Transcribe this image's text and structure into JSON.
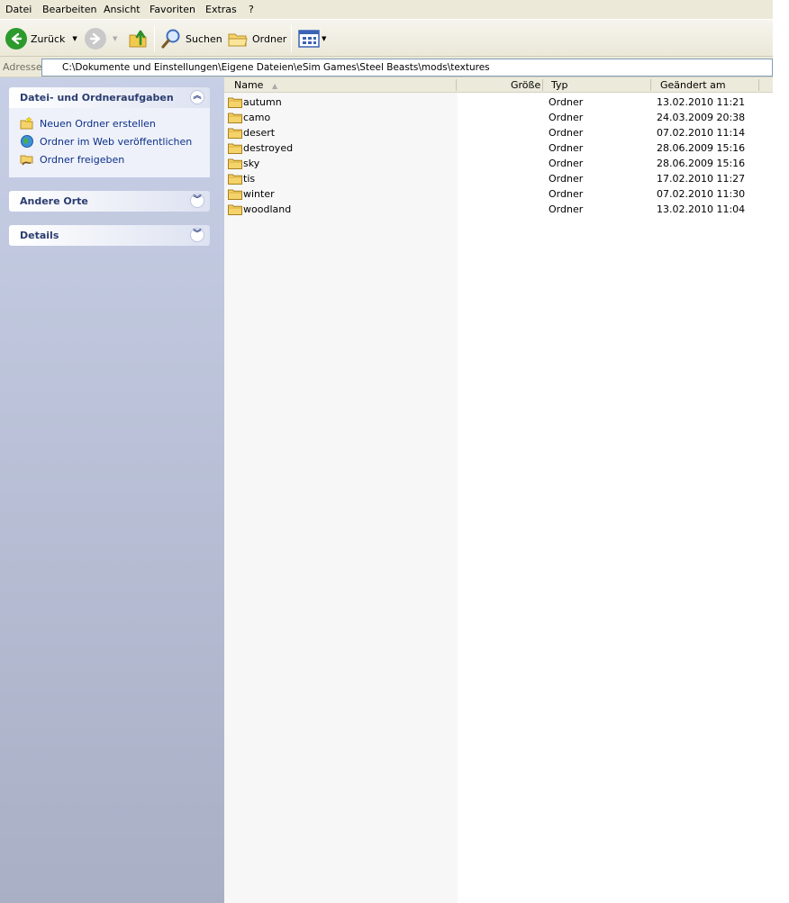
{
  "menu": [
    "Datei",
    "Bearbeiten",
    "Ansicht",
    "Favoriten",
    "Extras",
    "?"
  ],
  "toolbar": {
    "back_label": "Zurück",
    "search_label": "Suchen",
    "folders_label": "Ordner",
    "icons": [
      "back-arrow-icon",
      "forward-arrow-icon",
      "folder-up-icon",
      "search-icon",
      "folders-icon",
      "views-icon"
    ]
  },
  "address": {
    "label": "Adresse",
    "path": "C:\\Dokumente und Einstellungen\\Eigene Dateien\\eSim Games\\Steel Beasts\\mods\\textures"
  },
  "sidebar": {
    "panels": [
      {
        "title": "Datei- und Ordneraufgaben",
        "expanded": true,
        "tasks": [
          "Neuen Ordner erstellen",
          "Ordner im Web veröffentlichen",
          "Ordner freigeben"
        ]
      },
      {
        "title": "Andere Orte",
        "expanded": false
      },
      {
        "title": "Details",
        "expanded": false
      }
    ]
  },
  "filelist": {
    "columns": [
      "Name",
      "Größe",
      "Typ",
      "Geändert am"
    ],
    "sort_column": "Name",
    "rows": [
      {
        "name": "autumn",
        "size": "",
        "type": "Ordner",
        "modified": "13.02.2010 11:21"
      },
      {
        "name": "camo",
        "size": "",
        "type": "Ordner",
        "modified": "24.03.2009 20:38"
      },
      {
        "name": "desert",
        "size": "",
        "type": "Ordner",
        "modified": "07.02.2010 11:14"
      },
      {
        "name": "destroyed",
        "size": "",
        "type": "Ordner",
        "modified": "28.06.2009 15:16"
      },
      {
        "name": "sky",
        "size": "",
        "type": "Ordner",
        "modified": "28.06.2009 15:16"
      },
      {
        "name": "tis",
        "size": "",
        "type": "Ordner",
        "modified": "17.02.2010 11:27"
      },
      {
        "name": "winter",
        "size": "",
        "type": "Ordner",
        "modified": "07.02.2010 11:30"
      },
      {
        "name": "woodland",
        "size": "",
        "type": "Ordner",
        "modified": "13.02.2010 11:04"
      }
    ]
  },
  "colors": {
    "sidebar_top": "#c7cfe6",
    "sidebar_bottom": "#a9afc5",
    "task_link": "#0c2f88",
    "folder_yellow": "#f5d36b"
  }
}
